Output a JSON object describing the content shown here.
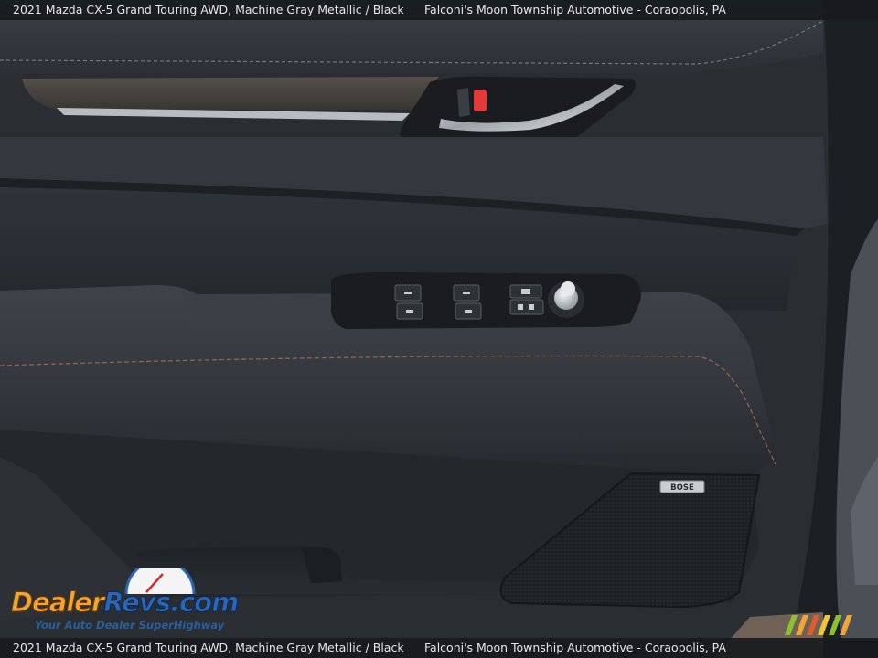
{
  "caption": {
    "title": "2021 Mazda CX-5 Grand Touring AWD,  Machine Gray Metallic / Black",
    "dealer": "Falconi's Moon Township Automotive - Coraopolis, PA"
  },
  "badge": {
    "text": "BOSE"
  },
  "watermark": {
    "brand_part1": "Dealer",
    "brand_part2": "Revs",
    "brand_part3": ".com",
    "tagline": "Your Auto Dealer SuperHighway",
    "colors": {
      "orange": "#f2a533",
      "blue": "#2a67b8"
    }
  },
  "colors": {
    "door_panel": "#2b2f35",
    "stitching": "#a86a4e",
    "handle_chrome": "#c9ccd0",
    "ambient_red": "#e03a3a"
  }
}
